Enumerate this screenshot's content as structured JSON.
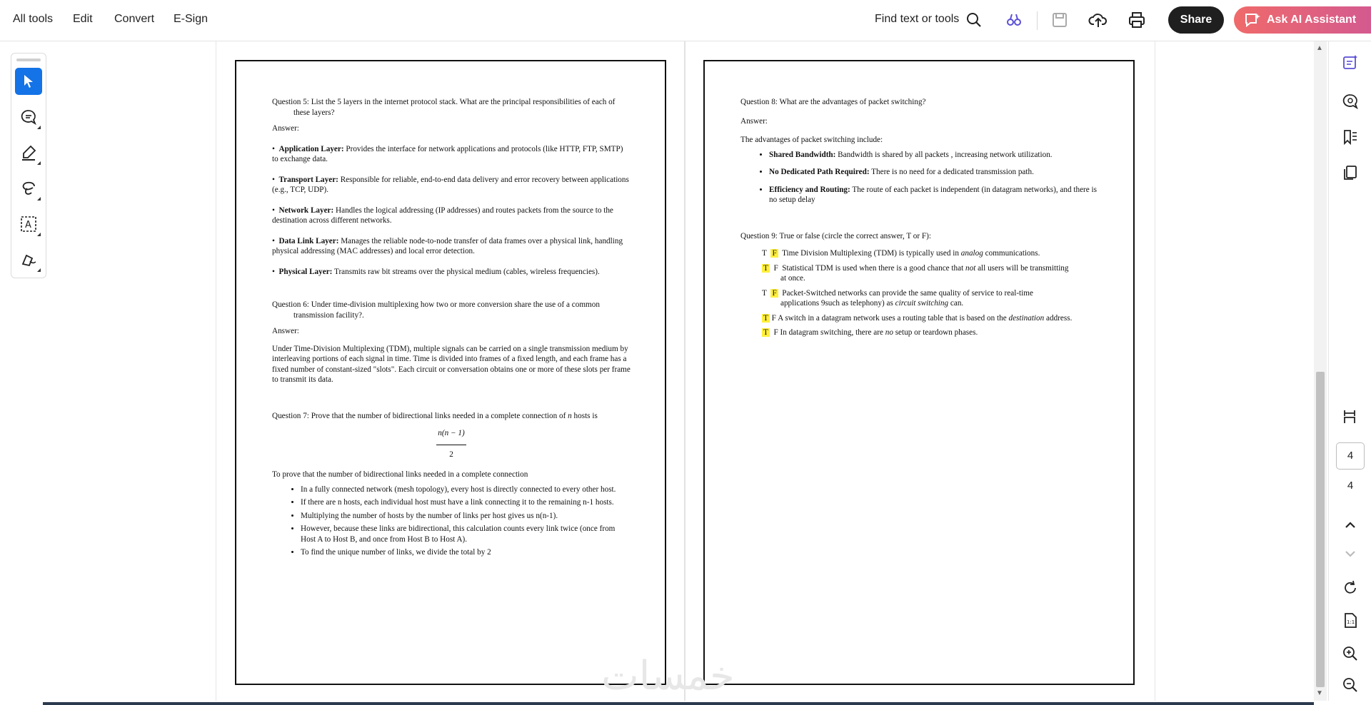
{
  "menu": {
    "all_tools": "All tools",
    "edit": "Edit",
    "convert": "Convert",
    "esign": "E-Sign"
  },
  "toolbar": {
    "find_label": "Find text or tools",
    "share_label": "Share",
    "ai_label": "Ask AI Assistant",
    "icons": [
      "search-icon",
      "compare-icon",
      "save-icon",
      "upload-cloud-icon",
      "print-icon"
    ]
  },
  "left_tools": [
    "select-cursor-icon",
    "comment-icon",
    "highlight-pen-icon",
    "draw-lasso-icon",
    "text-recognition-icon",
    "sign-icon"
  ],
  "right_panel": {
    "page_current": "4",
    "page_total": "4",
    "icons": [
      "ai-summary-icon",
      "comments-icon",
      "bookmarks-icon",
      "pages-icon",
      "reading-mode-icon",
      "scroll-up-icon",
      "scroll-down-icon",
      "rotate-icon",
      "fit-page-icon",
      "zoom-in-icon",
      "zoom-out-icon"
    ]
  },
  "watermark": "خمسات",
  "page_left": {
    "q5": "Question 5: List the 5 layers in the internet protocol stack. What are the principal responsibilities of each of these layers?",
    "answer": "Answer:",
    "layers": [
      {
        "name": "Application Layer:",
        "text": "Provides the interface for network applications and protocols (like HTTP, FTP, SMTP) to exchange data."
      },
      {
        "name": "Transport Layer:",
        "text": "Responsible for reliable, end-to-end data delivery and error recovery between applications (e.g., TCP, UDP)."
      },
      {
        "name": "Network Layer:",
        "text": "Handles the logical addressing (IP addresses) and routes packets from the source to the destination across different networks."
      },
      {
        "name": "Data Link Layer:",
        "text": "Manages the reliable node-to-node transfer of data frames over a physical link, handling physical addressing (MAC addresses) and local error detection."
      },
      {
        "name": "Physical Layer:",
        "text": "Transmits raw bit streams over the physical medium (cables, wireless frequencies)."
      }
    ],
    "q6": "Question 6: Under time-division multiplexing how two or more conversion share the use of a common transmission facility?.",
    "answer6": "Answer:",
    "tdm_text": "Under Time-Division Multiplexing (TDM), multiple signals can be carried on a single transmission medium by interleaving portions of each signal in time. Time is divided into frames of a fixed length, and each frame has a fixed number of constant-sized \"slots\". Each circuit or conversation obtains one or more of these slots per frame to transmit its data.",
    "q7_prefix": "Question 7: Prove that the number of bidirectional links needed in a complete connection of",
    "q7_n": "n",
    "q7_suffix": "hosts is",
    "frac_num": "n(n − 1)",
    "frac_den": "2",
    "proof_intro": "To prove that the number of bidirectional links needed in a complete connection",
    "proof_items": [
      "In a fully connected network (mesh topology), every host is directly connected to every other host.",
      "If there are n hosts, each individual host must have a link connecting it to the remaining n-1 hosts.",
      "Multiplying the number of hosts by the number of links per host gives us n(n-1).",
      "However, because these links are bidirectional, this calculation counts every link twice (once from Host A to Host B, and once from Host B to Host A).",
      "To find the unique number of links, we divide the total by 2"
    ]
  },
  "page_right": {
    "q8": "Question 8: What are the advantages of packet switching?",
    "answer": "Answer:",
    "intro": "The advantages of packet switching include:",
    "advantages": [
      {
        "name": "Shared Bandwidth:",
        "text": "Bandwidth is shared by all packets , increasing network utilization."
      },
      {
        "name": "No Dedicated Path Required:",
        "text": "There is no need for a dedicated transmission path."
      },
      {
        "name": "Efficiency and Routing:",
        "text": "The route of each packet is independent (in datagram networks), and there is no setup delay"
      }
    ],
    "q9": "Question 9: True or false (circle the correct answer, T or F):",
    "tf": [
      {
        "t": "T",
        "f": "F",
        "pre": "Time Division Multiplexing (TDM) is typically used in",
        "em": "analog",
        "post": "communications.",
        "cont": ""
      },
      {
        "t": "T",
        "f": "F",
        "pre": "Statistical TDM is used when there is a good chance that",
        "em": "not",
        "post": "all users will be transmitting",
        "cont": "at once."
      },
      {
        "t": "T",
        "f": "F",
        "pre": "Packet-Switched networks can provide the same quality of service to real-time",
        "em": "",
        "post": "",
        "cont": "applications 9such as telephony) as"
      },
      {
        "t": "T",
        "f": "F",
        "pre": "A switch in a datagram network uses a routing table that is based on the",
        "em": "destination",
        "post": "address.",
        "cont": ""
      },
      {
        "t": "T",
        "f": "F",
        "pre": "In datagram switching, there are",
        "em": "no",
        "post": "setup or teardown phases.",
        "cont": ""
      }
    ],
    "tf3_em": "circuit switching",
    "tf3_post": "can."
  }
}
